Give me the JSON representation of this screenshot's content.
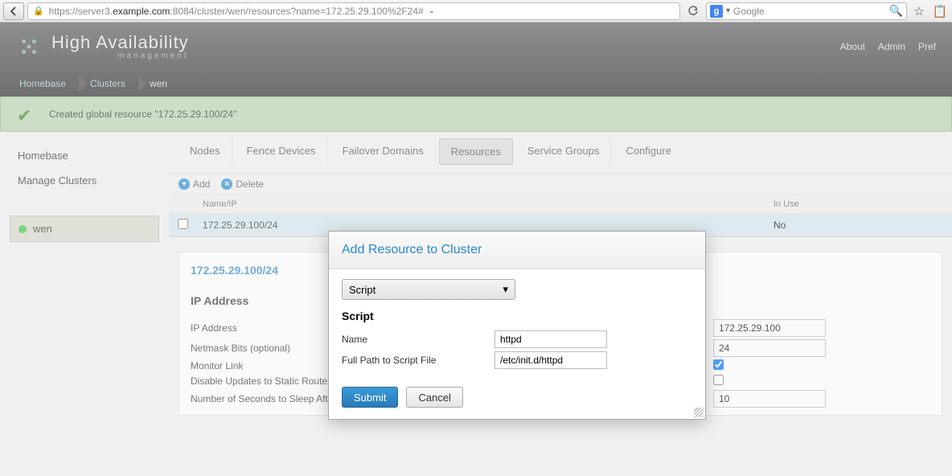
{
  "browser": {
    "url_prefix": "https://server3.",
    "url_host": "example.com",
    "url_suffix": ":8084/cluster/wen/resources?name=172.25.29.100%2F24#",
    "search_engine": "g",
    "search_placeholder": "Google"
  },
  "header": {
    "title": "High Availability",
    "subtitle": "management",
    "links": {
      "about": "About",
      "admin": "Admin",
      "pref": "Pref"
    }
  },
  "breadcrumb": [
    "Homebase",
    "Clusters",
    "wen"
  ],
  "notice": "Created global resource \"172.25.29.100/24\"",
  "sidebar": {
    "items": [
      {
        "label": "Homebase"
      },
      {
        "label": "Manage Clusters"
      }
    ],
    "selected": {
      "label": "wen",
      "status": "up"
    }
  },
  "tabs": [
    "Nodes",
    "Fence Devices",
    "Failover Domains",
    "Resources",
    "Service Groups",
    "Configure"
  ],
  "active_tab": "Resources",
  "toolbar": {
    "add": "Add",
    "delete": "Delete"
  },
  "table": {
    "columns": {
      "name": "Name/IP",
      "inuse": "In Use"
    },
    "rows": [
      {
        "name": "172.25.29.100/24",
        "inuse": "No"
      }
    ]
  },
  "detail": {
    "title": "172.25.29.100/24",
    "section": "IP Address",
    "fields": {
      "ip_label": "IP Address",
      "ip_value": "172.25.29.100",
      "mask_label": "Netmask Bits (optional)",
      "mask_value": "24",
      "monitor_label": "Monitor Link",
      "monitor_checked": true,
      "disable_label": "Disable Updates to Static Routes",
      "disable_checked": false,
      "sleep_label": "Number of Seconds to Sleep After Removing an IP Address",
      "sleep_value": "10"
    }
  },
  "modal": {
    "title": "Add Resource to Cluster",
    "type_selected": "Script",
    "section": "Script",
    "name_label": "Name",
    "name_value": "httpd",
    "path_label": "Full Path to Script File",
    "path_value": "/etc/init.d/httpd",
    "submit": "Submit",
    "cancel": "Cancel"
  }
}
